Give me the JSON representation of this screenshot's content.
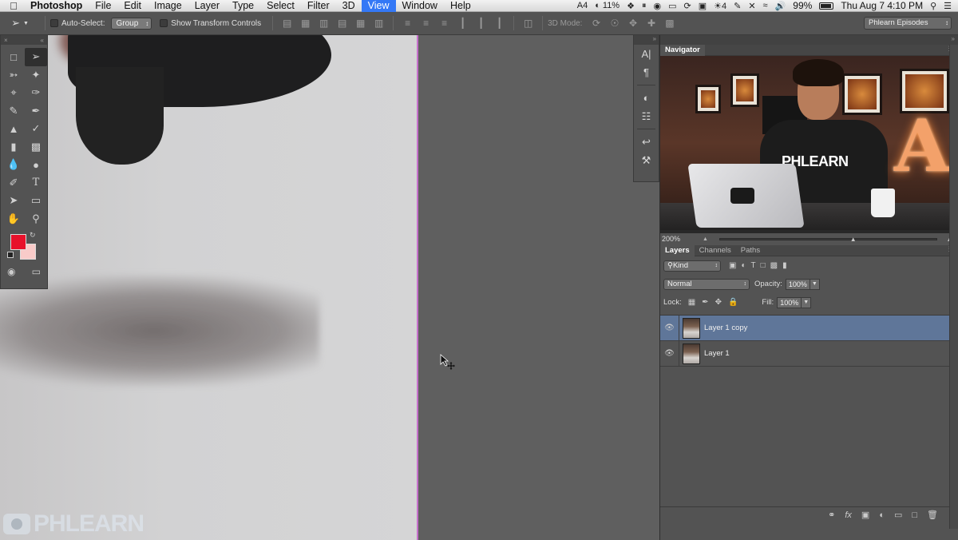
{
  "menubar": {
    "app_name": "Photoshop",
    "items": [
      "File",
      "Edit",
      "Image",
      "Layer",
      "Type",
      "Select",
      "Filter",
      "3D",
      "View",
      "Window",
      "Help"
    ],
    "active_item": "View",
    "status": {
      "adobe_count": "4",
      "cpu": "11%",
      "flag_count": "4",
      "battery": "99%",
      "clock": "Thu Aug 7  4:10 PM"
    }
  },
  "options_bar": {
    "auto_select_label": "Auto-Select:",
    "auto_select_value": "Group",
    "transform_controls_label": "Show Transform Controls",
    "mode_3d_label": "3D Mode:",
    "workspace": "Phlearn Episodes"
  },
  "tools": {
    "foreground_color": "#e8112b",
    "background_color": "#f9cbc9",
    "items": [
      "marquee-tool",
      "move-tool",
      "lasso-tool",
      "magic-wand-tool",
      "crop-tool",
      "eyedropper-tool",
      "healing-brush-tool",
      "brush-tool",
      "clone-stamp-tool",
      "history-brush-tool",
      "eraser-tool",
      "gradient-tool",
      "blur-tool",
      "dodge-tool",
      "pen-tool",
      "type-tool",
      "path-selection-tool",
      "rectangle-tool",
      "hand-tool",
      "zoom-tool"
    ]
  },
  "canvas": {
    "guide_color": "#c56fcc",
    "watermark": "PHLEARN"
  },
  "navigator": {
    "title": "Navigator",
    "zoom": "200%",
    "shirt_text": "PHLEARN"
  },
  "layers_panel": {
    "tabs": [
      "Layers",
      "Channels",
      "Paths"
    ],
    "active_tab": "Layers",
    "filter_kind": "Kind",
    "blend_mode": "Normal",
    "opacity_label": "Opacity:",
    "opacity_value": "100%",
    "lock_label": "Lock:",
    "fill_label": "Fill:",
    "fill_value": "100%",
    "layers": [
      {
        "name": "Layer 1 copy",
        "selected": true,
        "visible": true
      },
      {
        "name": "Layer 1",
        "selected": false,
        "visible": true
      }
    ]
  }
}
